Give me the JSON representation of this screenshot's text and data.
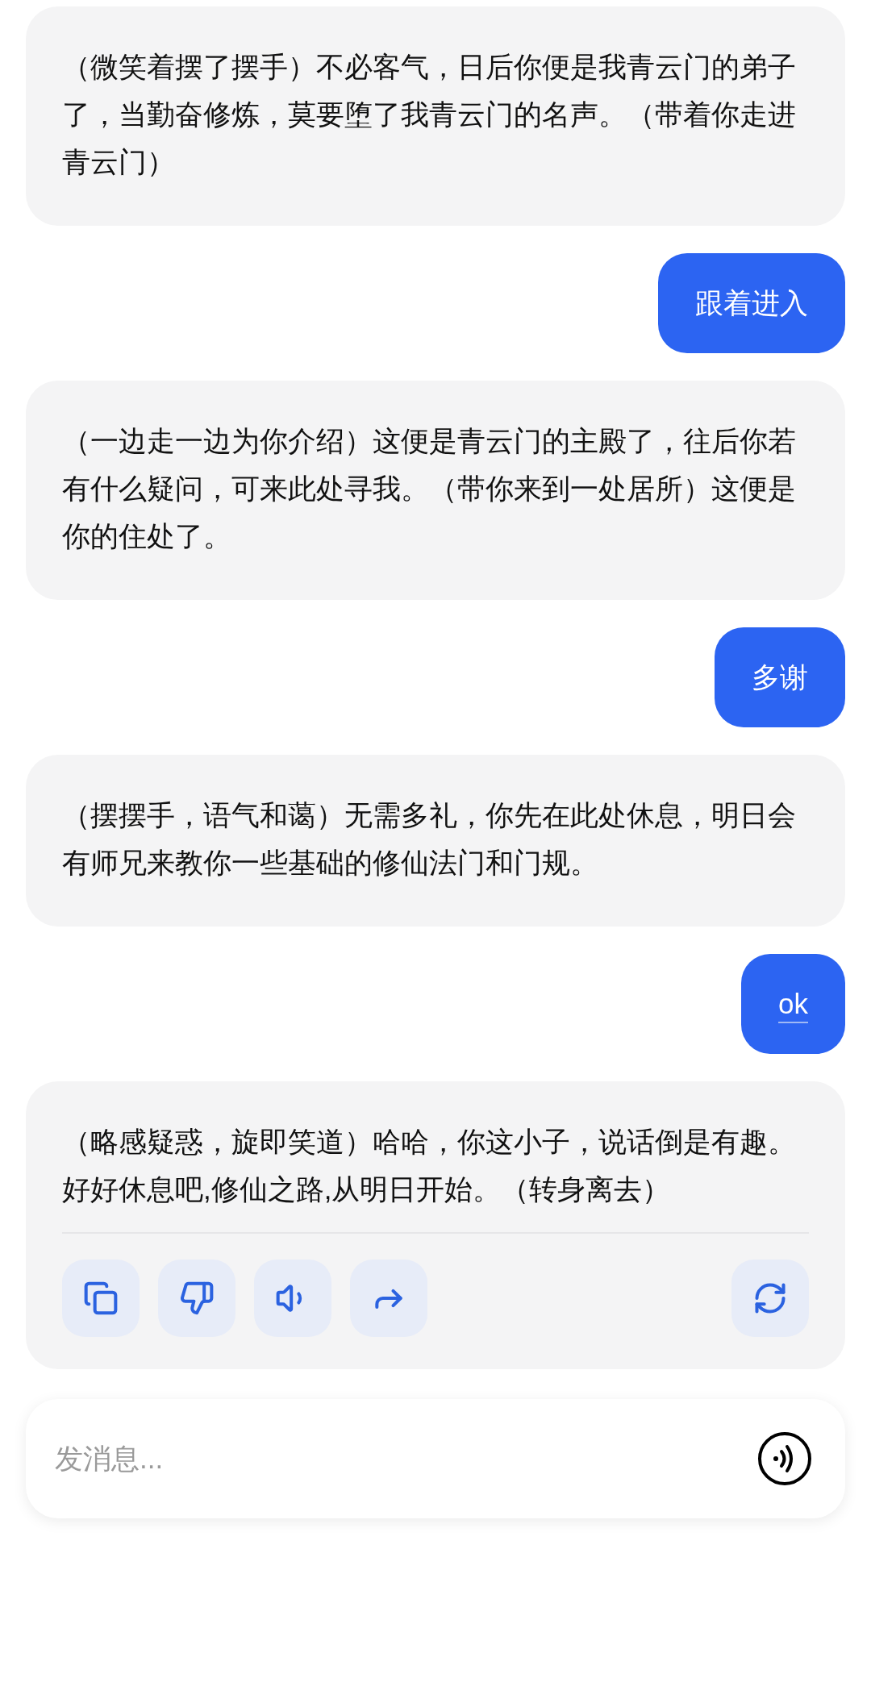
{
  "messages": [
    {
      "kind": "bot",
      "text": "（微笑着摆了摆手）不必客气，日后你便是我青云门的弟子了，当勤奋修炼，莫要堕了我青云门的名声。（带着你走进青云门）",
      "show_actions": false
    },
    {
      "kind": "user",
      "text": "跟着进入",
      "underlined": false
    },
    {
      "kind": "bot",
      "text": "（一边走一边为你介绍）这便是青云门的主殿了，往后你若有什么疑问，可来此处寻我。（带你来到一处居所）这便是你的住处了。",
      "show_actions": false
    },
    {
      "kind": "user",
      "text": "多谢",
      "underlined": false
    },
    {
      "kind": "bot",
      "text": "（摆摆手，语气和蔼）无需多礼，你先在此处休息，明日会有师兄来教你一些基础的修仙法门和门规。",
      "show_actions": false
    },
    {
      "kind": "user",
      "text": "ok",
      "underlined": true
    },
    {
      "kind": "bot",
      "text": "（略感疑惑，旋即笑道）哈哈，你这小子，说话倒是有趣。好好休息吧,修仙之路,从明日开始。（转身离去）",
      "show_actions": true
    }
  ],
  "composer": {
    "placeholder": "发消息..."
  }
}
